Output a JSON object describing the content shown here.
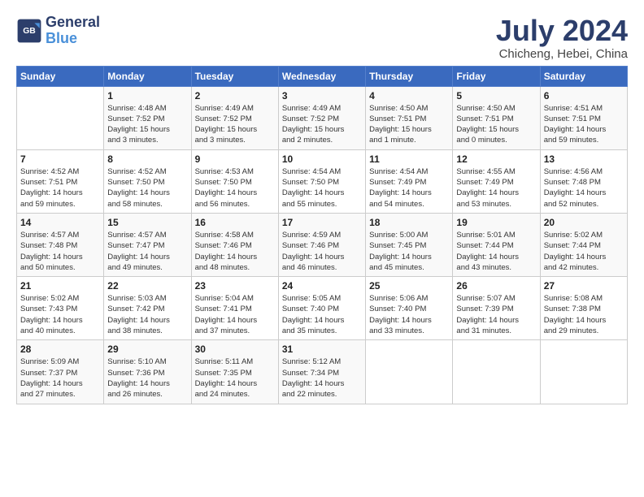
{
  "logo": {
    "line1": "General",
    "line2": "Blue"
  },
  "title": "July 2024",
  "subtitle": "Chicheng, Hebei, China",
  "weekdays": [
    "Sunday",
    "Monday",
    "Tuesday",
    "Wednesday",
    "Thursday",
    "Friday",
    "Saturday"
  ],
  "weeks": [
    [
      {
        "day": "",
        "info": ""
      },
      {
        "day": "1",
        "info": "Sunrise: 4:48 AM\nSunset: 7:52 PM\nDaylight: 15 hours\nand 3 minutes."
      },
      {
        "day": "2",
        "info": "Sunrise: 4:49 AM\nSunset: 7:52 PM\nDaylight: 15 hours\nand 3 minutes."
      },
      {
        "day": "3",
        "info": "Sunrise: 4:49 AM\nSunset: 7:52 PM\nDaylight: 15 hours\nand 2 minutes."
      },
      {
        "day": "4",
        "info": "Sunrise: 4:50 AM\nSunset: 7:51 PM\nDaylight: 15 hours\nand 1 minute."
      },
      {
        "day": "5",
        "info": "Sunrise: 4:50 AM\nSunset: 7:51 PM\nDaylight: 15 hours\nand 0 minutes."
      },
      {
        "day": "6",
        "info": "Sunrise: 4:51 AM\nSunset: 7:51 PM\nDaylight: 14 hours\nand 59 minutes."
      }
    ],
    [
      {
        "day": "7",
        "info": "Sunrise: 4:52 AM\nSunset: 7:51 PM\nDaylight: 14 hours\nand 59 minutes."
      },
      {
        "day": "8",
        "info": "Sunrise: 4:52 AM\nSunset: 7:50 PM\nDaylight: 14 hours\nand 58 minutes."
      },
      {
        "day": "9",
        "info": "Sunrise: 4:53 AM\nSunset: 7:50 PM\nDaylight: 14 hours\nand 56 minutes."
      },
      {
        "day": "10",
        "info": "Sunrise: 4:54 AM\nSunset: 7:50 PM\nDaylight: 14 hours\nand 55 minutes."
      },
      {
        "day": "11",
        "info": "Sunrise: 4:54 AM\nSunset: 7:49 PM\nDaylight: 14 hours\nand 54 minutes."
      },
      {
        "day": "12",
        "info": "Sunrise: 4:55 AM\nSunset: 7:49 PM\nDaylight: 14 hours\nand 53 minutes."
      },
      {
        "day": "13",
        "info": "Sunrise: 4:56 AM\nSunset: 7:48 PM\nDaylight: 14 hours\nand 52 minutes."
      }
    ],
    [
      {
        "day": "14",
        "info": "Sunrise: 4:57 AM\nSunset: 7:48 PM\nDaylight: 14 hours\nand 50 minutes."
      },
      {
        "day": "15",
        "info": "Sunrise: 4:57 AM\nSunset: 7:47 PM\nDaylight: 14 hours\nand 49 minutes."
      },
      {
        "day": "16",
        "info": "Sunrise: 4:58 AM\nSunset: 7:46 PM\nDaylight: 14 hours\nand 48 minutes."
      },
      {
        "day": "17",
        "info": "Sunrise: 4:59 AM\nSunset: 7:46 PM\nDaylight: 14 hours\nand 46 minutes."
      },
      {
        "day": "18",
        "info": "Sunrise: 5:00 AM\nSunset: 7:45 PM\nDaylight: 14 hours\nand 45 minutes."
      },
      {
        "day": "19",
        "info": "Sunrise: 5:01 AM\nSunset: 7:44 PM\nDaylight: 14 hours\nand 43 minutes."
      },
      {
        "day": "20",
        "info": "Sunrise: 5:02 AM\nSunset: 7:44 PM\nDaylight: 14 hours\nand 42 minutes."
      }
    ],
    [
      {
        "day": "21",
        "info": "Sunrise: 5:02 AM\nSunset: 7:43 PM\nDaylight: 14 hours\nand 40 minutes."
      },
      {
        "day": "22",
        "info": "Sunrise: 5:03 AM\nSunset: 7:42 PM\nDaylight: 14 hours\nand 38 minutes."
      },
      {
        "day": "23",
        "info": "Sunrise: 5:04 AM\nSunset: 7:41 PM\nDaylight: 14 hours\nand 37 minutes."
      },
      {
        "day": "24",
        "info": "Sunrise: 5:05 AM\nSunset: 7:40 PM\nDaylight: 14 hours\nand 35 minutes."
      },
      {
        "day": "25",
        "info": "Sunrise: 5:06 AM\nSunset: 7:40 PM\nDaylight: 14 hours\nand 33 minutes."
      },
      {
        "day": "26",
        "info": "Sunrise: 5:07 AM\nSunset: 7:39 PM\nDaylight: 14 hours\nand 31 minutes."
      },
      {
        "day": "27",
        "info": "Sunrise: 5:08 AM\nSunset: 7:38 PM\nDaylight: 14 hours\nand 29 minutes."
      }
    ],
    [
      {
        "day": "28",
        "info": "Sunrise: 5:09 AM\nSunset: 7:37 PM\nDaylight: 14 hours\nand 27 minutes."
      },
      {
        "day": "29",
        "info": "Sunrise: 5:10 AM\nSunset: 7:36 PM\nDaylight: 14 hours\nand 26 minutes."
      },
      {
        "day": "30",
        "info": "Sunrise: 5:11 AM\nSunset: 7:35 PM\nDaylight: 14 hours\nand 24 minutes."
      },
      {
        "day": "31",
        "info": "Sunrise: 5:12 AM\nSunset: 7:34 PM\nDaylight: 14 hours\nand 22 minutes."
      },
      {
        "day": "",
        "info": ""
      },
      {
        "day": "",
        "info": ""
      },
      {
        "day": "",
        "info": ""
      }
    ]
  ]
}
